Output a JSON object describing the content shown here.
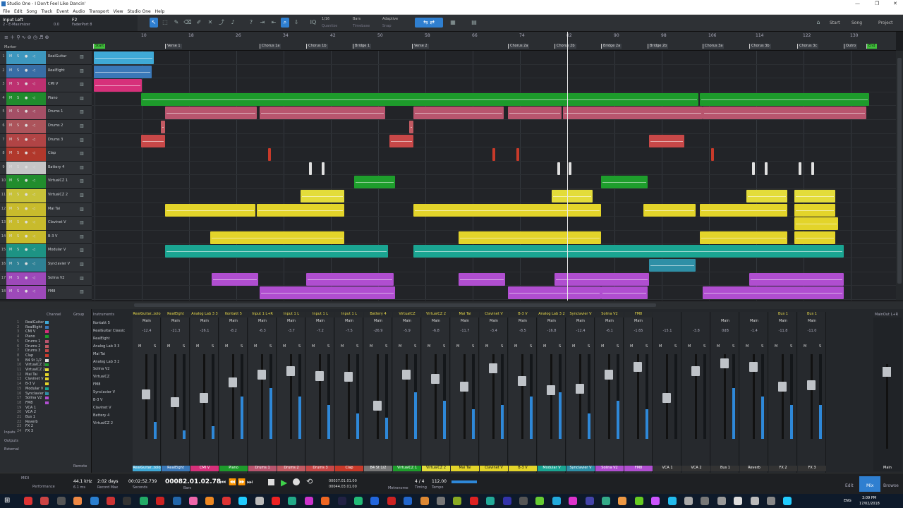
{
  "window": {
    "title": "Studio One - I Don't Feel Like Dancin'",
    "controls": [
      "—",
      "❐",
      "✕"
    ]
  },
  "menu": [
    "File",
    "Edit",
    "Song",
    "Track",
    "Event",
    "Audio",
    "Transport",
    "View",
    "Studio One",
    "Help"
  ],
  "inspector": {
    "input": "Input Left",
    "device": "2 - E-Maximizer",
    "f2": "F2",
    "faderport": "FaderPort 8",
    "val": "0.0 "
  },
  "toolbar": {
    "quantize_label": "Quantize",
    "quantize_val": "1/16",
    "timebase_label": "Timebase",
    "timebase_val": "Bars",
    "snap_label": "Snap",
    "snap_val": "Adaptive",
    "start": "Start",
    "song": "Song",
    "project": "Project"
  },
  "ruler": {
    "bars": [
      "10",
      "18",
      "26",
      "34",
      "42",
      "50",
      "58",
      "66",
      "74",
      "82",
      "90",
      "98",
      "106",
      "114",
      "122",
      "130"
    ],
    "markers": [
      "Start",
      "Verse 1",
      "Chorus 1a",
      "Chorus 1b",
      "Bridge 1",
      "Verse 2",
      "Chorus 2a",
      "Chorus 2b",
      "Bridge 2a",
      "Bridge 2b",
      "Chorus 3a",
      "Chorus 3b",
      "Chorus 3c",
      "Outro",
      "End"
    ],
    "marker_row": "Marker"
  },
  "tracks": [
    {
      "n": "1",
      "name": "RealGuitar",
      "color": "#3fa9d6"
    },
    {
      "n": "2",
      "name": "RealEight",
      "color": "#3a78b8"
    },
    {
      "n": "3",
      "name": "CMI V",
      "color": "#d6307a"
    },
    {
      "n": "4",
      "name": "Piano",
      "color": "#1d9b2b"
    },
    {
      "n": "5",
      "name": "Drums 1",
      "color": "#b8556e"
    },
    {
      "n": "6",
      "name": "Drums 2",
      "color": "#c25a62"
    },
    {
      "n": "7",
      "name": "Drums 3",
      "color": "#c84848"
    },
    {
      "n": "8",
      "name": "Clap",
      "color": "#c83a2a"
    },
    {
      "n": "9",
      "name": "Battery 4",
      "color": "#e0e0e0"
    },
    {
      "n": "10",
      "name": "VirtualCZ 1",
      "color": "#1e9e2c"
    },
    {
      "n": "11",
      "name": "VirtualCZ 2",
      "color": "#e3dc3a"
    },
    {
      "n": "12",
      "name": "Mai Tai",
      "color": "#e3d42a"
    },
    {
      "n": "13",
      "name": "Clavinet V",
      "color": "#e3d42a"
    },
    {
      "n": "14",
      "name": "B-3 V",
      "color": "#e3d42a"
    },
    {
      "n": "15",
      "name": "Modular V",
      "color": "#1aa592"
    },
    {
      "n": "16",
      "name": "Synclavier V",
      "color": "#2e8fa6"
    },
    {
      "n": "17",
      "name": "Solina V2",
      "color": "#b04ed0"
    },
    {
      "n": "18",
      "name": "FM8",
      "color": "#b04ed0"
    }
  ],
  "mixer_list": [
    "RealGuitar",
    "RealEight",
    "CMI V",
    "Piano",
    "Drums 1",
    "Drums 2",
    "Drums 3",
    "Clap",
    "B4 St 1/2",
    "VirtualCZ 1",
    "VirtualCZ 2",
    "Mai Tai",
    "Clavinet V",
    "B-3 V",
    "Modular V",
    "Synclavier V",
    "Solina V2",
    "FM8",
    "VCA 1",
    "VCA 2",
    "Bus 1",
    "Reverb",
    "FX 2",
    "FX 3"
  ],
  "instruments": [
    "Kontakt 5",
    "RealGuitar Classic",
    "RealEight",
    "Analog Lab 3 3",
    "Mai Tai",
    "Analog Lab 3 2",
    "Solina V2",
    "VirtualCZ",
    "FM8",
    "Synclavier V",
    "B-3 V",
    "Clavinet V",
    "Battery 4",
    "VirtualCZ 2"
  ],
  "mixer_side": {
    "channel": "Channel",
    "group": "Group",
    "instruments": "Instruments",
    "inputs": "Inputs",
    "outputs": "Outputs",
    "external": "External",
    "remote": "Remote",
    "main_out": "MainOut L+R"
  },
  "channels": [
    {
      "top": "RealGuitar..zolo",
      "route": "Main",
      "vol": "-12.4",
      "label": "RealGuitar..zolo",
      "color": "#3fa9d6",
      "fader": 0.55,
      "meter": 0.2
    },
    {
      "top": "RealEight",
      "route": "Main",
      "vol": "-21.3",
      "label": "RealEight",
      "color": "#3a78b8",
      "fader": 0.45,
      "meter": 0.1
    },
    {
      "top": "Analog Lab 3 3",
      "route": "Main",
      "vol": "-26.1",
      "label": "CMI V",
      "color": "#d6307a",
      "fader": 0.5,
      "meter": 0.15
    },
    {
      "top": "Kontakt 5",
      "route": "Main",
      "vol": "-8.2",
      "label": "Piano",
      "color": "#1d9b2b",
      "fader": 0.7,
      "meter": 0.5
    },
    {
      "top": "Input 1 L+R",
      "route": "Main",
      "vol": "-6.3",
      "label": "Drums 1",
      "color": "#b8556e",
      "fader": 0.8,
      "meter": 0.6
    },
    {
      "top": "Input 1 L",
      "route": "Main",
      "vol": "-3.7",
      "label": "Drums 2",
      "color": "#c25a62",
      "fader": 0.85,
      "meter": 0.5
    },
    {
      "top": "Input 1 L",
      "route": "Main",
      "vol": "-7.2",
      "label": "Drums 3",
      "color": "#c84848",
      "fader": 0.78,
      "meter": 0.4
    },
    {
      "top": "Input 1 L",
      "route": "Main",
      "vol": "-7.5",
      "label": "Clap",
      "color": "#c83a2a",
      "fader": 0.77,
      "meter": 0.3
    },
    {
      "top": "Battery 4",
      "route": "Main",
      "vol": "-26.9",
      "label": "B4 St 1/2",
      "color": "#777777",
      "fader": 0.4,
      "meter": 0.25
    },
    {
      "top": "VirtualCZ",
      "route": "Main",
      "vol": "-5.9",
      "label": "VirtualCZ 1",
      "color": "#1e9e2c",
      "fader": 0.8,
      "meter": 0.55
    },
    {
      "top": "VirtualCZ 2",
      "route": "Main",
      "vol": "-6.8",
      "label": "VirtualCZ 2",
      "color": "#e3dc3a",
      "fader": 0.75,
      "meter": 0.45
    },
    {
      "top": "Mai Tai",
      "route": "Main",
      "vol": "-11.7",
      "label": "Mai Tai",
      "color": "#e3d42a",
      "fader": 0.65,
      "meter": 0.35
    },
    {
      "top": "Clavinet V",
      "route": "Main",
      "vol": "-3.4",
      "label": "Clavinet V",
      "color": "#e3d42a",
      "fader": 0.88,
      "meter": 0.4
    },
    {
      "top": "B-3 V",
      "route": "Main",
      "vol": "-8.5",
      "label": "B-3 V",
      "color": "#e3d42a",
      "fader": 0.72,
      "meter": 0.5
    },
    {
      "top": "Analog Lab 3 2",
      "route": "Main",
      "vol": "-16.8",
      "label": "Modular V",
      "color": "#1aa592",
      "fader": 0.6,
      "meter": 0.55
    },
    {
      "top": "Synclavier V",
      "route": "Main",
      "vol": "-12.4",
      "label": "Synclavier V",
      "color": "#2e8fa6",
      "fader": 0.62,
      "meter": 0.3
    },
    {
      "top": "Solina V2",
      "route": "Main",
      "vol": "-6.1",
      "label": "Solina V2",
      "color": "#b04ed0",
      "fader": 0.8,
      "meter": 0.45
    },
    {
      "top": "FM8",
      "route": "Main",
      "vol": "-1.65",
      "label": "FM8",
      "color": "#b04ed0",
      "fader": 0.9,
      "meter": 0.35
    },
    {
      "top": "",
      "route": "",
      "vol": "-15.1",
      "label": "VCA 1",
      "color": "#333333",
      "fader": 0.5,
      "meter": 0
    },
    {
      "top": "",
      "route": "",
      "vol": "-3.8",
      "label": "VCA 2",
      "color": "#333333",
      "fader": 0.85,
      "meter": 0
    },
    {
      "top": "",
      "route": "Main",
      "vol": "0dB",
      "label": "Bus 1",
      "color": "#333333",
      "fader": 0.95,
      "meter": 0.6
    },
    {
      "top": "",
      "route": "Main",
      "vol": "-1.4",
      "label": "Reverb",
      "color": "#333333",
      "fader": 0.9,
      "meter": 0.5
    },
    {
      "top": "Bus 1",
      "route": "Main",
      "vol": "-11.8",
      "label": "FX 2",
      "color": "#333333",
      "fader": 0.65,
      "meter": 0.4
    },
    {
      "top": "Bus 1",
      "route": "Main",
      "vol": "-11.0",
      "label": "FX 3",
      "color": "#333333",
      "fader": 0.66,
      "meter": 0.4
    }
  ],
  "main_label": "Main",
  "transport": {
    "midi": "MIDI",
    "performance": "Performance",
    "rate": "44.1 kHz",
    "latency": "6.1 ms",
    "rec_max": "2:02 days",
    "rec_max_label": "Record Max",
    "seconds": "00:02:52.739",
    "seconds_label": "Seconds",
    "bars": "00082.01.02.78",
    "bars_label": "Bars",
    "loop_l": "00037.01.01.00",
    "loop_r": "00044.03.01.00",
    "sig": "4 / 4",
    "sig_label": "Timing",
    "tempo": "112.00",
    "tempo_label": "Tempo",
    "metronome": "Metronome",
    "edit": "Edit",
    "mix": "Mix",
    "browse": "Browse"
  },
  "tray": {
    "time": "3:09 PM",
    "date": "17/02/2018",
    "lang": "ENG"
  }
}
